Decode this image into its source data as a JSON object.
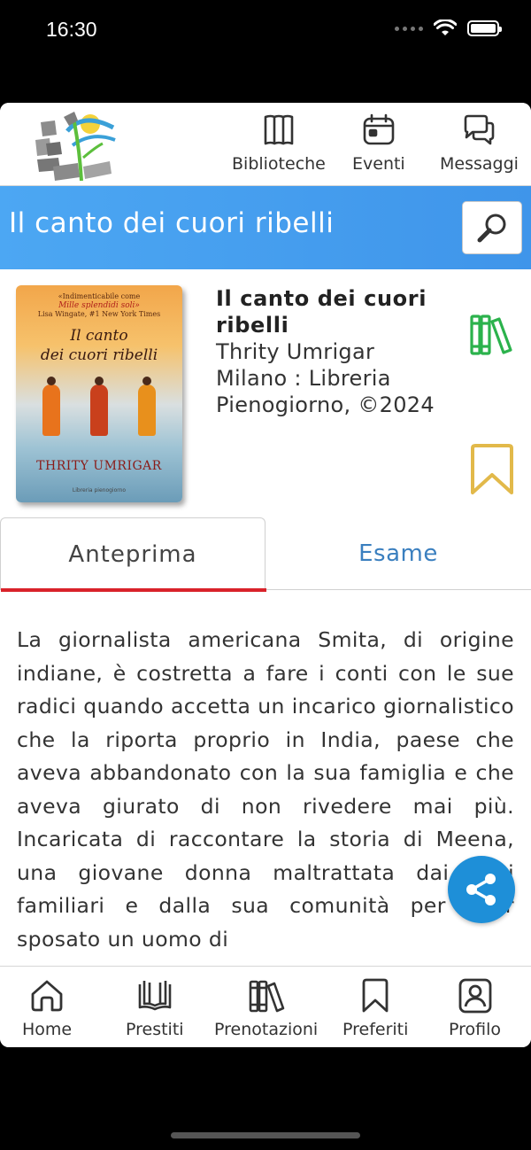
{
  "status_bar": {
    "time": "16:30"
  },
  "header": {
    "logo_icon": "library-logo",
    "nav": [
      {
        "label": "Biblioteche",
        "icon": "book-open-icon"
      },
      {
        "label": "Eventi",
        "icon": "calendar-icon"
      },
      {
        "label": "Messaggi",
        "icon": "messages-icon"
      }
    ]
  },
  "title_bar": {
    "title": "Il canto dei cuori ribelli",
    "search_icon": "search-icon"
  },
  "book": {
    "title": "Il canto dei cuori ribelli",
    "author": "Thrity Umrigar",
    "publication": "Milano : Libreria Pienogiorno, ©2024",
    "cover": {
      "tagline_1": "«Indimenticabile come",
      "tagline_2": "Mille splendidi soli»",
      "tagline_3": "Lisa Wingate, #1 New York Times",
      "title_line_1": "Il canto",
      "title_line_2": "dei cuori ribelli",
      "author": "THRITY UMRIGAR",
      "publisher": "Libreria pienogiorno"
    },
    "hold_icon": "books-hold-icon",
    "hold_color": "#2bb24c",
    "bookmark_icon": "bookmark-icon",
    "bookmark_color": "#e2b94a"
  },
  "tabs": [
    {
      "label": "Anteprima",
      "active": true
    },
    {
      "label": "Esame",
      "active": false
    }
  ],
  "description": "La giornalista americana Smita, di origine indiane, è costretta a fare i conti con le sue radici quando accetta un incarico giornalistico che la riporta proprio in India, paese che aveva abbandonato con la sua famiglia e che aveva giurato di non rivedere mai più. Incaricata di raccontare la storia di Meena, una giovane donna maltrattata dai suoi familiari e dalla sua comunità per aver sposato un uomo di",
  "share_icon": "share-icon",
  "bottom_nav": [
    {
      "label": "Home",
      "icon": "home-icon"
    },
    {
      "label": "Prestiti",
      "icon": "loans-icon"
    },
    {
      "label": "Prenotazioni",
      "icon": "reservations-icon"
    },
    {
      "label": "Preferiti",
      "icon": "bookmark-icon"
    },
    {
      "label": "Profilo",
      "icon": "profile-icon"
    }
  ],
  "colors": {
    "accent_blue": "#4ca7f3",
    "tab_active_underline": "#d9222a",
    "tab_inactive_text": "#3a7fbf",
    "share_fab": "#1e8fd8"
  }
}
